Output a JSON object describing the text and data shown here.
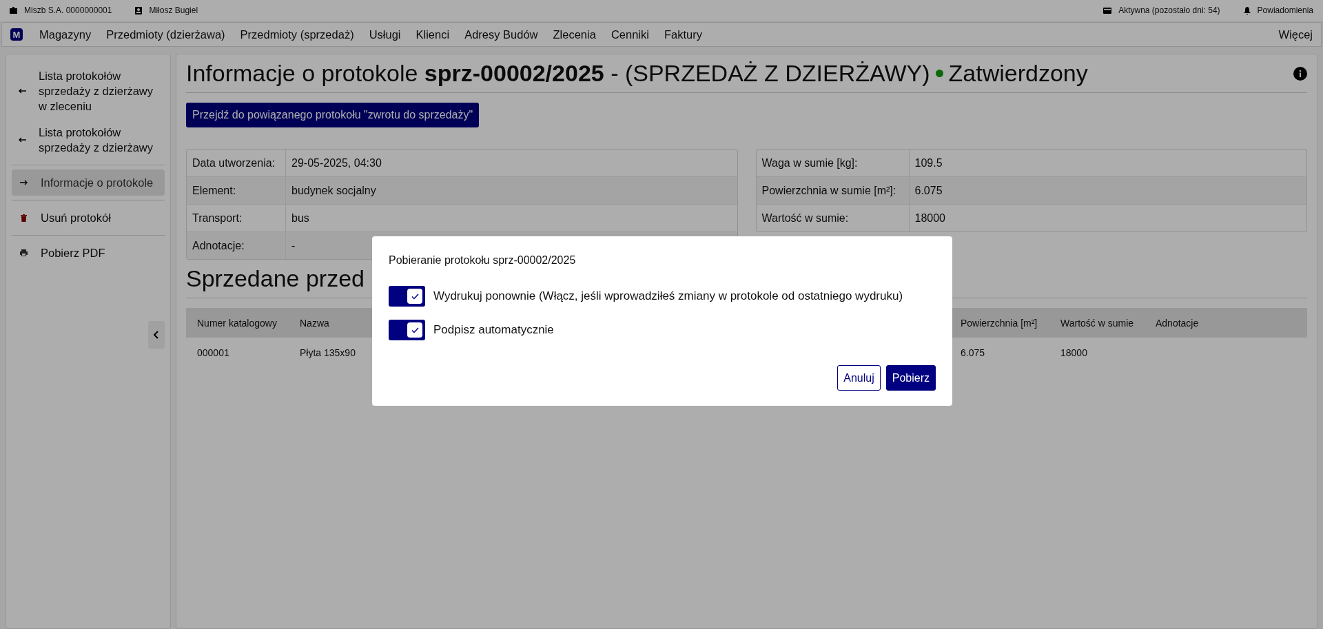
{
  "top_bar": {
    "company": "Miszb S.A. 0000000001",
    "user": "Miłosz Bugiel",
    "subscription": "Aktywna (pozostało dni: 54)",
    "notifications": "Powiadomienia"
  },
  "nav": {
    "logo": "M",
    "items": [
      "Magazyny",
      "Przedmioty (dzierżawa)",
      "Przedmioty (sprzedaż)",
      "Usługi",
      "Klienci",
      "Adresy Budów",
      "Zlecenia",
      "Cenniki",
      "Faktury"
    ],
    "more": "Więcej"
  },
  "sidebar": {
    "items": [
      {
        "kind": "back",
        "label": "Lista protokołów sprzedaży z dzierżawy w zleceniu",
        "selected": false
      },
      {
        "kind": "back",
        "label": "Lista protokołów sprzedaży z dzierżawy",
        "selected": false
      },
      {
        "kind": "current",
        "label": "Informacje o protokole",
        "selected": true
      },
      {
        "kind": "delete",
        "label": "Usuń protokół",
        "selected": false
      },
      {
        "kind": "pdf",
        "label": "Pobierz PDF",
        "selected": false
      }
    ]
  },
  "header": {
    "title": "Informacje o protokole",
    "number": "sprz-00002/2025",
    "type": "- (SPRZEDAŻ Z DZIERŻAWY)",
    "status": "Zatwierdzony"
  },
  "related_button": "Przejdź do powiązanego protokołu \"zwrotu do sprzedaży\"",
  "details_left": [
    {
      "label": "Data utworzenia:",
      "value": "29-05-2025, 04:30"
    },
    {
      "label": "Element:",
      "value": "budynek socjalny"
    },
    {
      "label": "Transport:",
      "value": "bus"
    },
    {
      "label": "Adnotacje:",
      "value": "-"
    }
  ],
  "details_right": [
    {
      "label": "Waga w sumie [kg]:",
      "value": "109.5"
    },
    {
      "label": "Powierzchnia w sumie [m²]:",
      "value": "6.075"
    },
    {
      "label": "Wartość w sumie:",
      "value": "18000"
    }
  ],
  "items_section": {
    "heading": "Sprzedane przed",
    "columns": [
      "Numer katalogowy",
      "Nazwa",
      "Powierzchnia [m²]",
      "Wartość w sumie",
      "Adnotacje"
    ],
    "rows": [
      {
        "cells": [
          "000001",
          "Płyta 135x90",
          "6.075",
          "18000"
        ]
      }
    ]
  },
  "modal": {
    "title": "Pobieranie protokołu sprz-00002/2025",
    "options": [
      {
        "label": "Wydrukuj ponownie (Włącz, jeśli wprowadziłeś zmiany w protokole od ostatniego wydruku)",
        "on": true
      },
      {
        "label": "Podpisz automatycznie",
        "on": true
      }
    ],
    "buttons": [
      {
        "kind": "secondary",
        "label": "Anuluj"
      },
      {
        "kind": "primary",
        "label": "Pobierz"
      }
    ]
  }
}
